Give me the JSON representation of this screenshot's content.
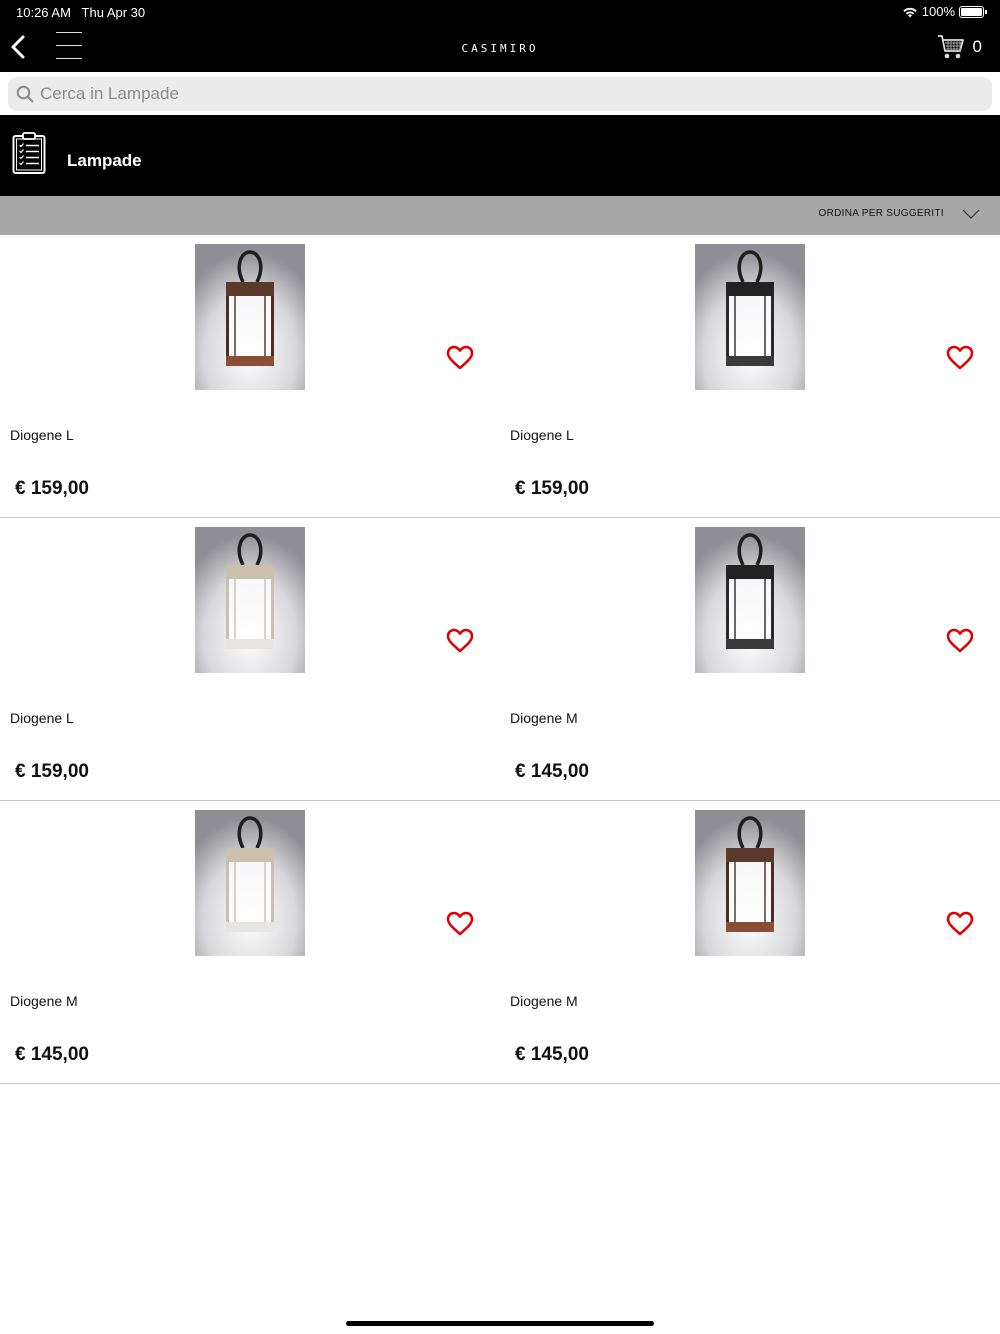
{
  "status": {
    "time": "10:26 AM",
    "date": "Thu Apr 30",
    "battery": "100%"
  },
  "header": {
    "brand": "CASIMIRO",
    "cart_count": "0"
  },
  "search": {
    "placeholder": "Cerca in Lampade",
    "value": ""
  },
  "category": {
    "title": "Lampade"
  },
  "sort": {
    "label": "ORDINA PER SUGGERITI"
  },
  "colors": {
    "bar": "#000000",
    "sort_bar": "#a7a7a7",
    "favorite": "#e00000",
    "divider": "#c8c8c8"
  },
  "products": [
    {
      "name": "Diogene L",
      "price": "€ 159,00",
      "finish": "corten"
    },
    {
      "name": "Diogene L",
      "price": "€ 159,00",
      "finish": "black"
    },
    {
      "name": "Diogene L",
      "price": "€ 159,00",
      "finish": "sand"
    },
    {
      "name": "Diogene M",
      "price": "€ 145,00",
      "finish": "black"
    },
    {
      "name": "Diogene M",
      "price": "€ 145,00",
      "finish": "sand"
    },
    {
      "name": "Diogene M",
      "price": "€ 145,00",
      "finish": "corten"
    }
  ]
}
